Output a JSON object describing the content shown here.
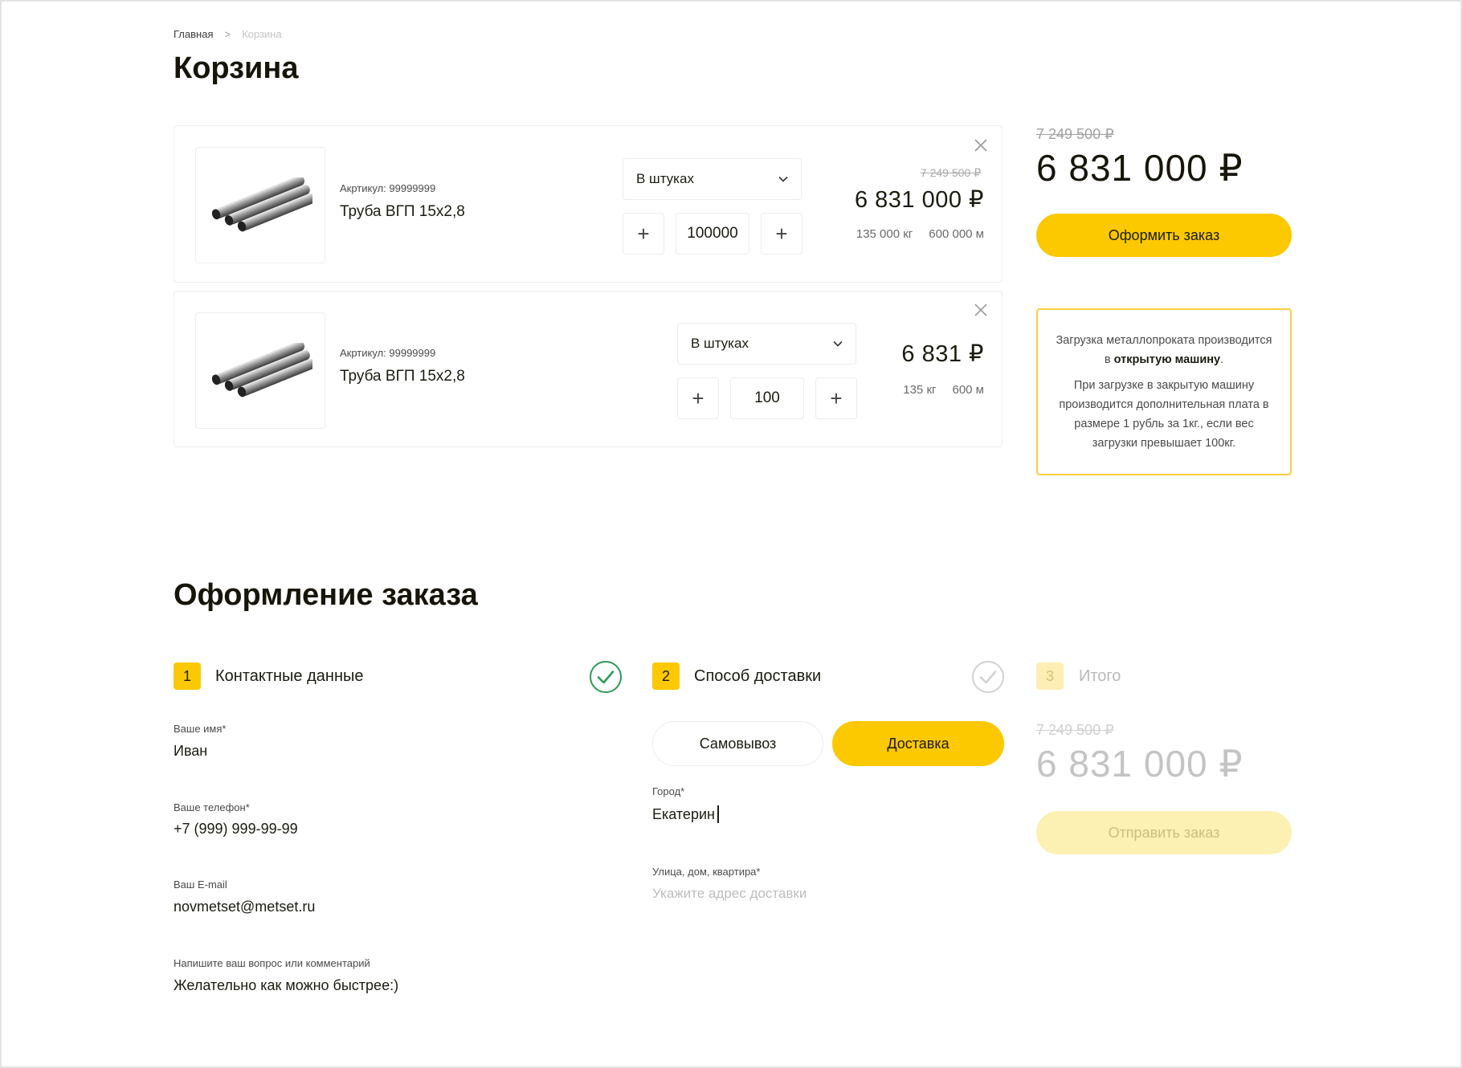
{
  "breadcrumb": {
    "home": "Главная",
    "separator": ">",
    "current": "Корзина"
  },
  "page_title": "Корзина",
  "cart": {
    "items": [
      {
        "sku": "Акртикул: 99999999",
        "name": "Труба ВГП 15x2,8",
        "unit": "В штуках",
        "quantity": "100000",
        "old_price": "7 249 500 ₽",
        "price": "6 831 000 ₽",
        "weight": "135 000 кг",
        "length": "600 000 м"
      },
      {
        "sku": "Акртикул: 99999999",
        "name": "Труба ВГП 15x2,8",
        "unit": "В штуках",
        "quantity": "100",
        "price": "6 831 ₽",
        "weight": "135 кг",
        "length": "600 м"
      }
    ],
    "qty_minus": "+",
    "qty_plus": "+"
  },
  "summary": {
    "old_price": "7 249 500 ₽",
    "price": "6 831 000 ₽",
    "order_button": "Оформить заказ",
    "notice_p1_a": "Загрузка металлопроката производится в ",
    "notice_p1_b": "открытую машину",
    "notice_p1_c": ".",
    "notice_p2": "При загрузке в закрытую машину производится дополнительная плата в размере 1 рубль за 1кг., если вес загрузки превышает 100кг."
  },
  "checkout": {
    "title": "Оформление заказа",
    "steps": [
      {
        "num": "1",
        "label": "Контактные данные"
      },
      {
        "num": "2",
        "label": "Способ доставки"
      },
      {
        "num": "3",
        "label": "Итого"
      }
    ],
    "contact": {
      "name_label": "Ваше имя*",
      "name_value": "Иван",
      "phone_label": "Ваше телефон*",
      "phone_value": "+7 (999) 999-99-99",
      "email_label": "Ваш E-mail",
      "email_value": "novmetset@metset.ru",
      "comment_label": "Напишите ваш вопрос или комментарий",
      "comment_value": "Желательно как можно быстрее:)"
    },
    "delivery": {
      "pickup": "Самовывоз",
      "delivery": "Доставка",
      "city_label": "Город*",
      "city_value": "Екатерин",
      "street_label": "Улица, дом, квартира*",
      "street_placeholder": "Укажите адрес доставки"
    },
    "total": {
      "old_price": "7 249 500 ₽",
      "price": "6 831 000 ₽",
      "send_button": "Отправить заказ"
    }
  },
  "colors": {
    "accent": "#fcc800",
    "accent_light": "#fdf0b3",
    "check_green": "#2e9a57",
    "check_gray": "#cfcfcf"
  }
}
